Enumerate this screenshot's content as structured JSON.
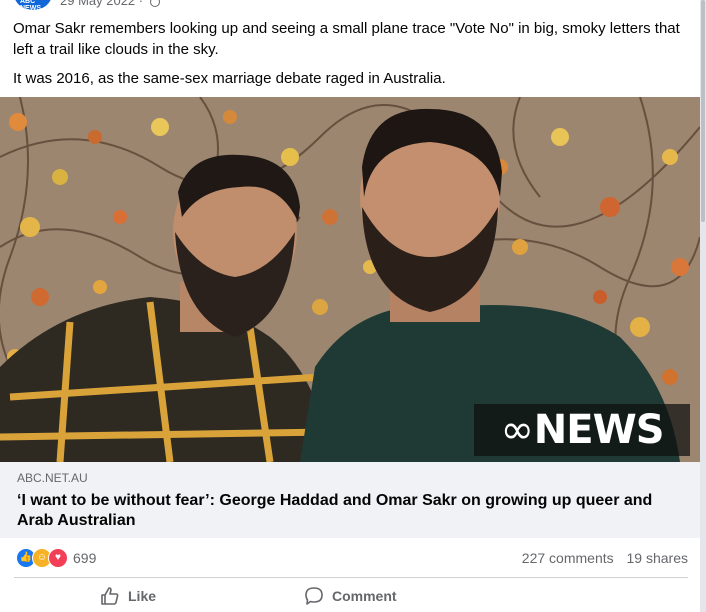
{
  "header": {
    "avatar_text": "ABC NEWS",
    "date": "29 May 2022 ·"
  },
  "post": {
    "paragraph_1": "Omar Sakr remembers looking up and seeing a small plane trace \"Vote No\" in big, smoky letters that left a trail like clouds in the sky.",
    "paragraph_2": "It was 2016, as the same-sex marriage debate raged in Australia."
  },
  "link_preview": {
    "watermark": "NEWS",
    "domain": "ABC.NET.AU",
    "title": "‘I want to be without fear’: George Haddad and Omar Sakr on growing up queer and Arab Australian"
  },
  "engagement": {
    "reaction_count": "699",
    "comments": "227 comments",
    "shares": "19 shares",
    "reactions": [
      "like-icon",
      "care-icon",
      "love-icon"
    ]
  },
  "actions": {
    "like_label": "Like",
    "comment_label": "Comment"
  },
  "colors": {
    "like_blue": "#1877f2",
    "love_red": "#f33e58",
    "care_yellow": "#f7b125",
    "caption_bg": "#f0f2f5",
    "text_secondary": "#65676b"
  }
}
